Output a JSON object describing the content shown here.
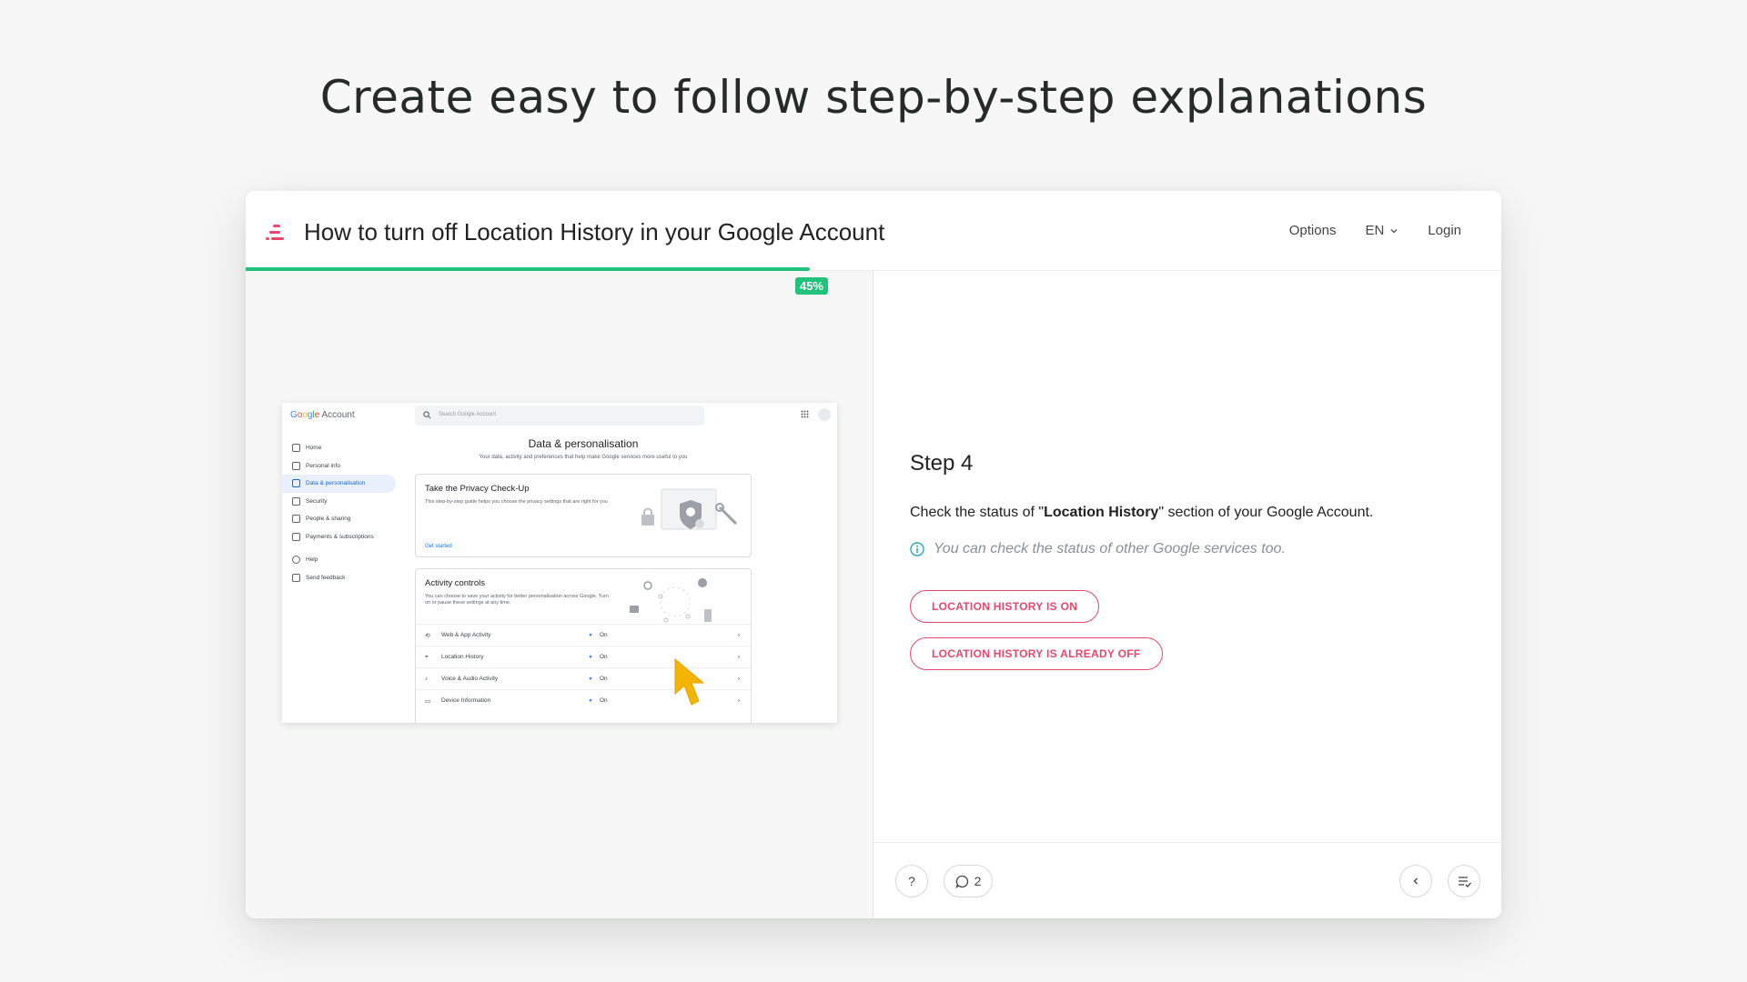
{
  "hero": {
    "title": "Create easy to follow step-by-step explanations"
  },
  "header": {
    "guide_title": "How to turn off Location History in your Google Account",
    "options_label": "Options",
    "language_label": "EN",
    "login_label": "Login"
  },
  "progress": {
    "percent": 45,
    "label": "45%"
  },
  "screenshot": {
    "logo_g": "G",
    "logo_o1": "o",
    "logo_o2": "o",
    "logo_g2": "g",
    "logo_l": "l",
    "logo_e": "e",
    "logo_account": "Account",
    "search_placeholder": "Search Google Account",
    "nav": [
      "Home",
      "Personal info",
      "Data & personalisation",
      "Security",
      "People & sharing",
      "Payments & subscriptions",
      "Help",
      "Send feedback"
    ],
    "page_heading": "Data & personalisation",
    "page_subheading": "Your data, activity and preferences that help make Google services more useful to you",
    "privacy_card": {
      "title": "Take the Privacy Check-Up",
      "description": "This step-by-step guide helps you choose the privacy settings that are right for you",
      "link": "Get started"
    },
    "activity_card": {
      "title": "Activity controls",
      "description": "You can choose to save your activity for better personalisation across Google. Turn on or pause these settings at any time.",
      "rows": [
        {
          "label": "Web & App Activity",
          "status": "On"
        },
        {
          "label": "Location History",
          "status": "On"
        },
        {
          "label": "Voice & Audio Activity",
          "status": "On"
        },
        {
          "label": "Device Information",
          "status": "On"
        }
      ]
    }
  },
  "step": {
    "title": "Step 4",
    "desc_prefix": "Check the status of \"",
    "desc_bold": "Location History",
    "desc_suffix": "\" section of your Google Account.",
    "note": "You can check the status of other Google services too.",
    "choices": [
      "LOCATION HISTORY IS ON",
      "LOCATION HISTORY IS ALREADY OFF"
    ]
  },
  "footer": {
    "help_label": "?",
    "comments_count": "2"
  },
  "colors": {
    "accent": "#e8476b",
    "progress": "#22c27c",
    "info": "#2aa6c9"
  }
}
